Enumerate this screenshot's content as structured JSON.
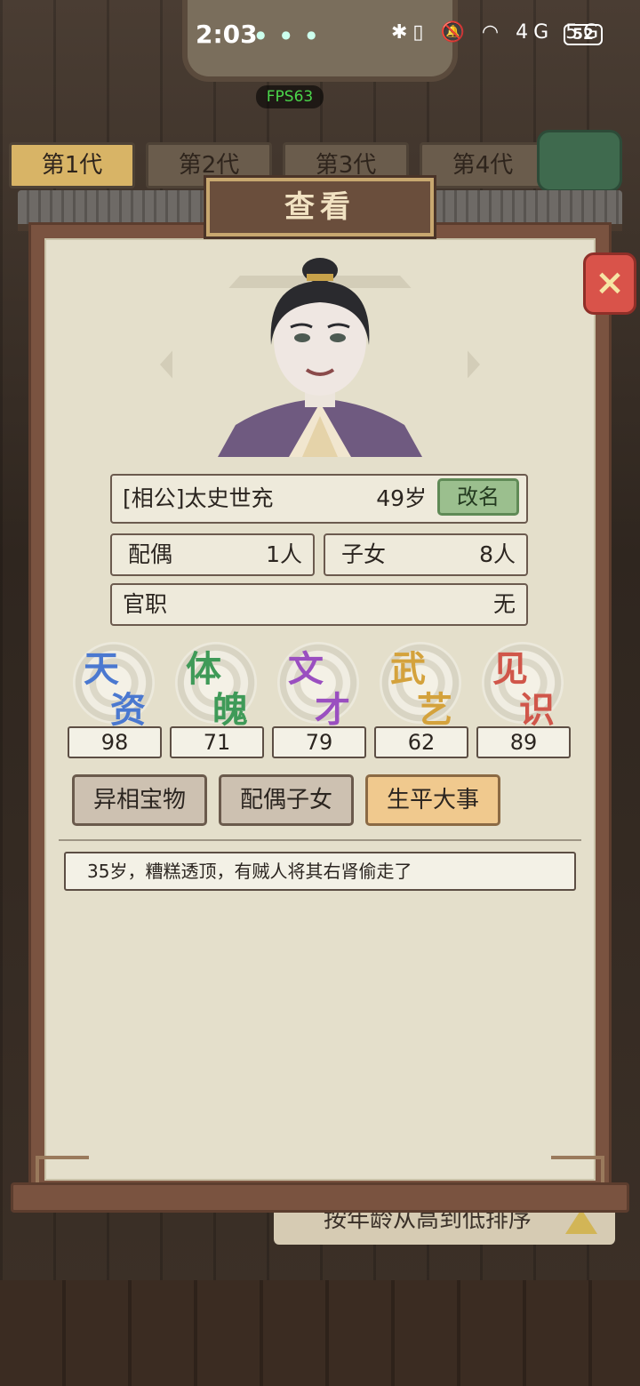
{
  "status_bar": {
    "time": "2:03",
    "icons": "✱▯ 🔕 ◠ 4G 5G",
    "battery": "52"
  },
  "fps": "FPS63",
  "background": {
    "generation_tabs": [
      "第1代",
      "第2代",
      "第3代",
      "第4代"
    ],
    "sort_label": "按年龄从高到低排序"
  },
  "dialog": {
    "title": "查看",
    "close_icon": "×",
    "character": {
      "name": "[相公]太史世充",
      "age": "49岁",
      "rename_label": "改名",
      "spouse_label": "配偶",
      "spouse_value": "1人",
      "children_label": "子女",
      "children_value": "8人",
      "office_label": "官职",
      "office_value": "无"
    },
    "stats": [
      {
        "top": "天",
        "bottom": "资",
        "value": "98",
        "color": "#4a78d0"
      },
      {
        "top": "体",
        "bottom": "魄",
        "value": "71",
        "color": "#3f9a58"
      },
      {
        "top": "文",
        "bottom": "才",
        "value": "79",
        "color": "#9a4fc0"
      },
      {
        "top": "武",
        "bottom": "艺",
        "value": "62",
        "color": "#d4a23c"
      },
      {
        "top": "见",
        "bottom": "识",
        "value": "89",
        "color": "#d0564a"
      }
    ],
    "tabs": [
      "异相宝物",
      "配偶子女",
      "生平大事"
    ],
    "active_tab": "生平大事",
    "events": [
      "35岁，糟糕透顶，有贼人将其右肾偷走了"
    ]
  }
}
